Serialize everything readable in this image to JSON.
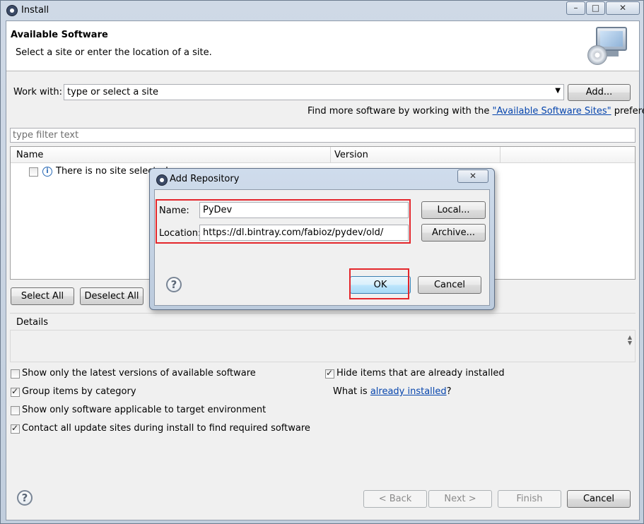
{
  "window": {
    "title": "Install",
    "minimize_glyph": "–",
    "maximize_glyph": "□",
    "close_glyph": "✕"
  },
  "header": {
    "title": "Available Software",
    "subtitle": "Select a site or enter the location of a site."
  },
  "work_with": {
    "label": "Work with:",
    "value": "type or select a site",
    "add_button": "Add...",
    "find_more_prefix": "Find more software by working with the ",
    "find_more_link": "\"Available Software Sites\"",
    "find_more_suffix": " preferences."
  },
  "filter": {
    "placeholder": "type filter text"
  },
  "table": {
    "columns": [
      "Name",
      "Version"
    ],
    "rows": [
      {
        "name": "There is no site selected.",
        "checked": false
      }
    ]
  },
  "selection_buttons": {
    "select_all": "Select All",
    "deselect_all": "Deselect All"
  },
  "details": {
    "label": "Details"
  },
  "options": {
    "show_latest": {
      "label": "Show only the latest versions of available software",
      "checked": false
    },
    "group_by_category": {
      "label": "Group items by category",
      "checked": true
    },
    "show_applicable": {
      "label": "Show only software applicable to target environment",
      "checked": false
    },
    "contact_all_sites": {
      "label": "Contact all update sites during install to find required software",
      "checked": true
    },
    "hide_installed": {
      "label": "Hide items that are already installed",
      "checked": true
    },
    "what_is_prefix": "What is ",
    "what_is_link": "already installed",
    "what_is_suffix": "?"
  },
  "footer": {
    "back": "< Back",
    "next": "Next >",
    "finish": "Finish",
    "cancel": "Cancel"
  },
  "dialog": {
    "title": "Add Repository",
    "name_label": "Name:",
    "name_value": "PyDev",
    "location_label": "Location:",
    "location_value": "https://dl.bintray.com/fabioz/pydev/old/",
    "local_button": "Local...",
    "archive_button": "Archive...",
    "ok_button": "OK",
    "cancel_button": "Cancel",
    "close_glyph": "✕"
  },
  "colors": {
    "highlight_box": "#e4262b",
    "link": "#0645ad"
  }
}
